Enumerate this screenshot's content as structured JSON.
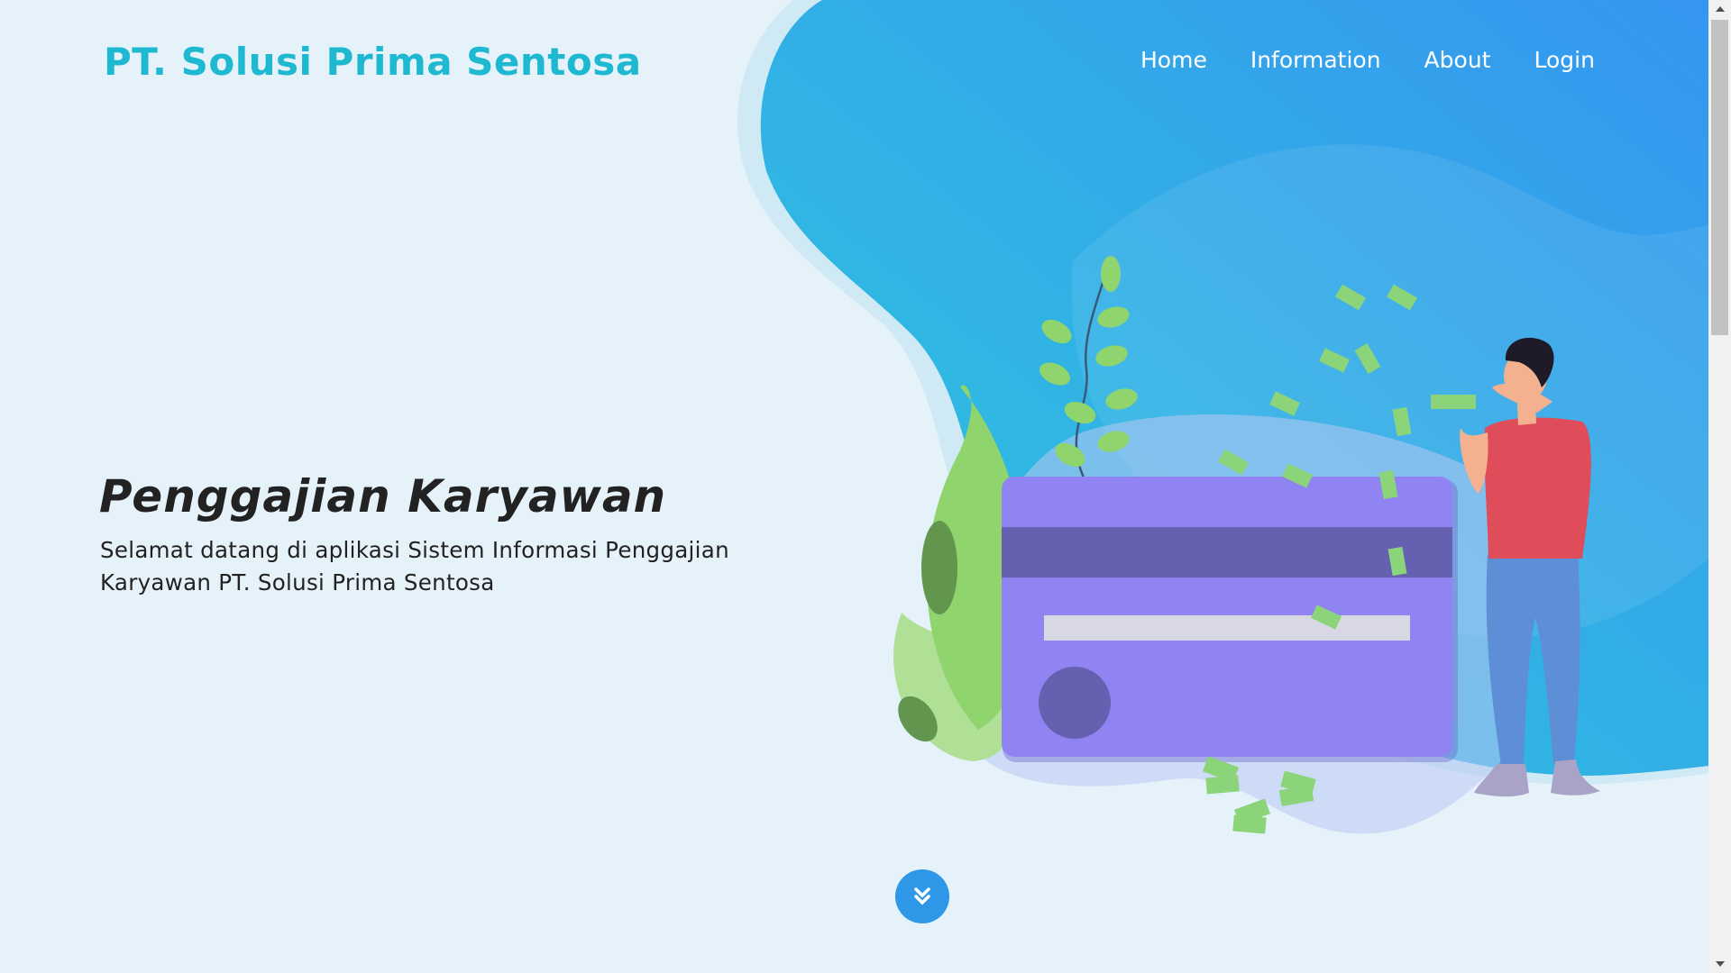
{
  "brand": {
    "name": "PT. Solusi Prima Sentosa"
  },
  "nav": {
    "items": [
      {
        "label": "Home"
      },
      {
        "label": "Information"
      },
      {
        "label": "About"
      },
      {
        "label": "Login"
      }
    ]
  },
  "hero": {
    "title": "Penggajian Karyawan",
    "subtitle": "Selamat datang di aplikasi Sistem Informasi Penggajian Karyawan PT. Solusi Prima Sentosa"
  },
  "scroll_down": {
    "icon": "double-chevron-down-icon"
  },
  "colors": {
    "brand": "#1fb8d1",
    "page_background": "#e6f2fa",
    "blob_start": "#2ec9dc",
    "blob_end": "#3596f0",
    "card": "#8f84f2",
    "card_stripe": "#6560b0",
    "money": "#8cd47a",
    "shirt": "#e04d5a",
    "pants": "#5e8fd6",
    "scroll_button": "#2e97e8"
  }
}
